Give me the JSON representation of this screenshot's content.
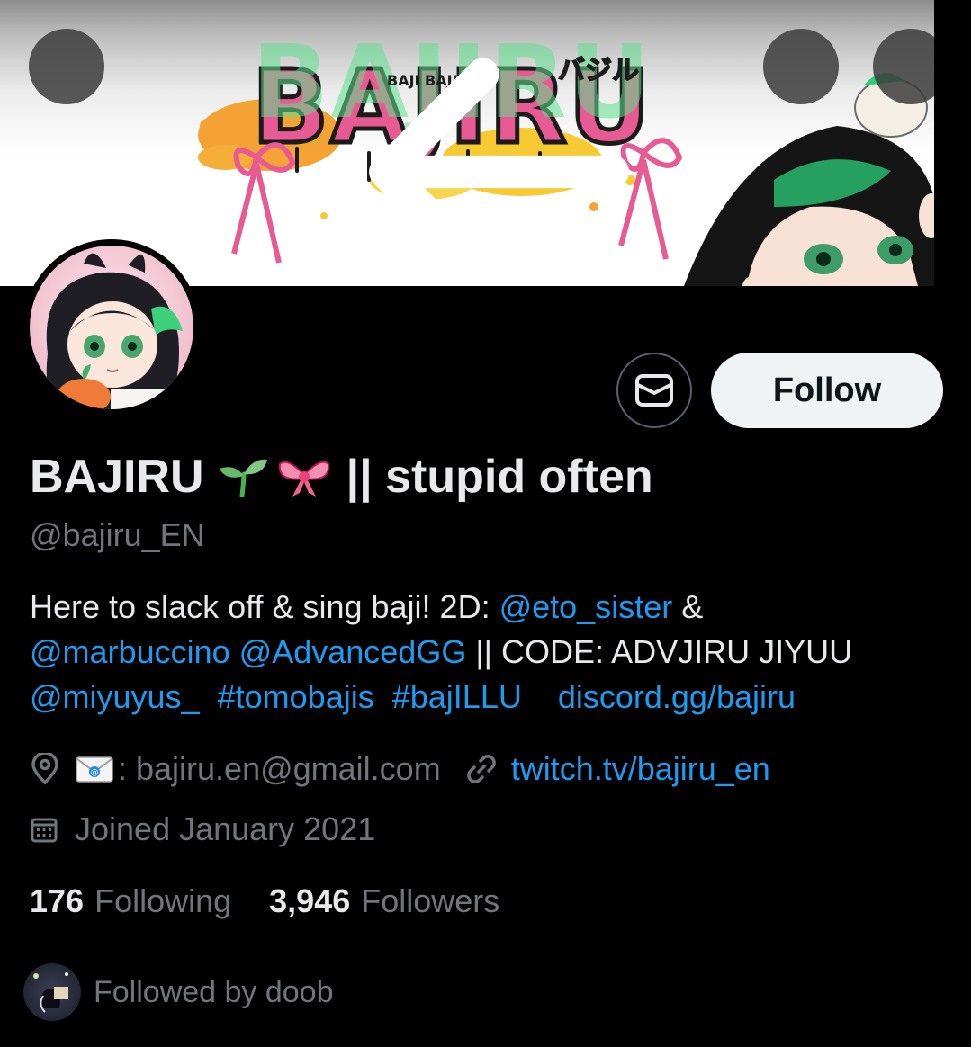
{
  "header": {
    "banner_logo_text": "BAJIRU",
    "banner_small_text": "BAJI BAJI!",
    "banner_katakana": "バジル"
  },
  "profile": {
    "display_name_main": "BAJIRU",
    "display_name_suffix": "|| stupid often",
    "emojis": [
      "seedling-emoji",
      "ribbon-emoji"
    ],
    "handle": "@bajiru_EN",
    "bio": {
      "line1_text": "Here to slack off & sing baji!  2D: ",
      "line1_link": "@eto_sister",
      "line1_after": " &",
      "line2_link1": "@marbuccino",
      "line2_link2": "@AdvancedGG",
      "line2_text": " || CODE: ADVJIRU JIYUU",
      "line3_link1": "@miyuyus_",
      "line3_link2": "#tomobajis",
      "line3_link3": "#bajILLU",
      "line3_link4": "discord.gg/bajiru"
    },
    "location_text": ": bajiru.en@gmail.com",
    "website": "twitch.tv/bajiru_en",
    "joined": "Joined January 2021",
    "following_count": "176",
    "following_label": "Following",
    "followers_count": "3,946",
    "followers_label": "Followers",
    "followed_by": "Followed by doob"
  },
  "actions": {
    "follow_label": "Follow"
  },
  "colors": {
    "accent": "#1d9bf0",
    "text": "#e7e9ea",
    "muted": "#71767b",
    "background": "#000000"
  }
}
